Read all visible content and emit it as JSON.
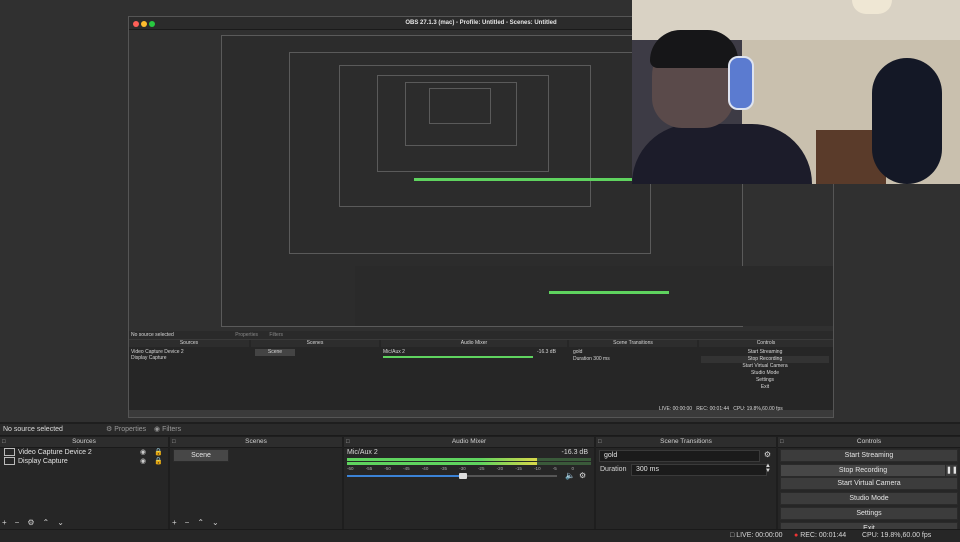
{
  "window": {
    "title": "OBS 27.1.3 (mac) - Profile: Untitled - Scenes: Untitled"
  },
  "context_bar": {
    "no_source": "No source selected",
    "properties": "Properties",
    "filters": "Filters"
  },
  "docks": {
    "sources": "Sources",
    "scenes": "Scenes",
    "audio_mixer": "Audio Mixer",
    "scene_transitions": "Scene Transitions",
    "controls": "Controls"
  },
  "sources": [
    {
      "name": "Video Capture Device 2"
    },
    {
      "name": "Display Capture"
    }
  ],
  "scenes": [
    {
      "name": "Scene"
    }
  ],
  "mixer": {
    "channel": "Mic/Aux 2",
    "level": "-16.3 dB",
    "ticks": [
      "-60",
      "-55",
      "-50",
      "-45",
      "-40",
      "-35",
      "-30",
      "-25",
      "-20",
      "-15",
      "-10",
      "-5",
      "0"
    ],
    "meter_fraction": 0.78,
    "volume_fraction": 0.55
  },
  "transitions": {
    "selected": "gold",
    "duration_label": "Duration",
    "duration_value": "300 ms"
  },
  "controls": {
    "start_streaming": "Start Streaming",
    "stop_recording": "Stop Recording",
    "start_virtual_camera": "Start Virtual Camera",
    "studio_mode": "Studio Mode",
    "settings": "Settings",
    "exit": "Exit"
  },
  "status": {
    "live": "LIVE: 00:00:00",
    "rec": "REC: 00:01:44",
    "cpu": "CPU: 19.8%,60.00 fps"
  },
  "nested": {
    "no_source": "No source selected",
    "properties": "Properties",
    "filters": "Filters",
    "sources": "Sources",
    "scenes": "Scenes",
    "audio_mixer": "Audio Mixer",
    "scene_transitions": "Scene Transitions",
    "controls": "Controls",
    "rec": "REC: 00:01:44",
    "live": "LIVE: 00:00:00",
    "cpu": "CPU: 19.8%,60.00 fps"
  },
  "colors": {
    "meter_green": "#5fd35f",
    "meter_yellow": "#d8d84a",
    "volume_blue": "#3b82d6",
    "record_red": "#e33"
  }
}
